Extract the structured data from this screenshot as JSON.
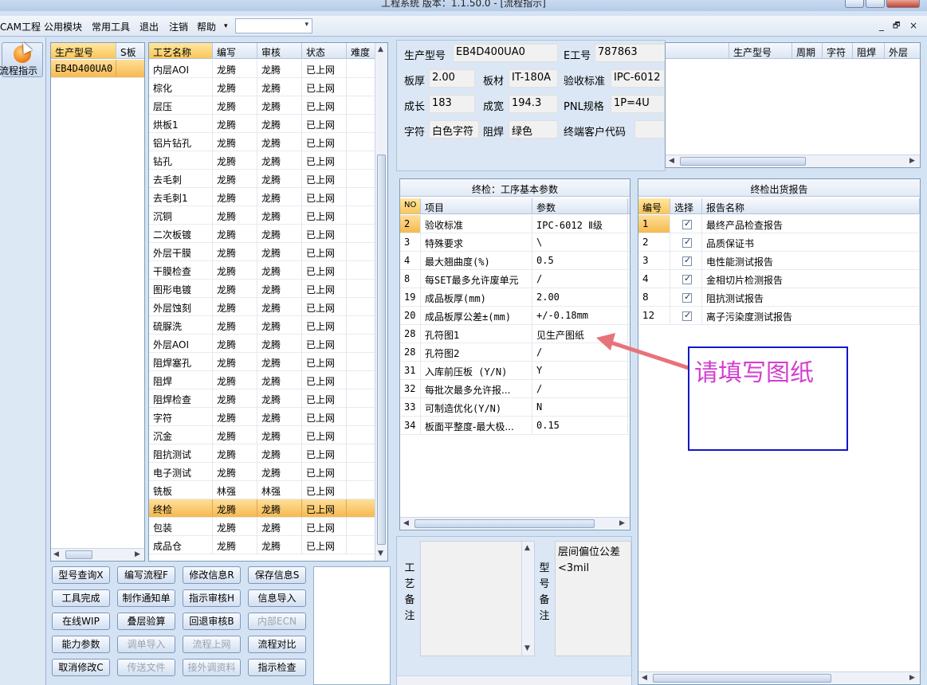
{
  "window": {
    "title": "工程系统   版本：1.1.50.0 - [流程指示]"
  },
  "menu": {
    "items": [
      "CAM工程",
      "公用模块",
      "常用工具",
      "退出",
      "注销",
      "帮助"
    ],
    "dropdown_arrow": "▾",
    "combo_value": ""
  },
  "mdi_controls": [
    "_",
    "🗗",
    "×"
  ],
  "nav": {
    "flow_button_label": "流程指示"
  },
  "product_list": {
    "headers": [
      "生产型号",
      "S板"
    ],
    "rows": [
      [
        "EB4D400UA0",
        ""
      ]
    ]
  },
  "process_table": {
    "headers": [
      "工艺名称",
      "编写",
      "审核",
      "状态",
      "难度"
    ],
    "rows": [
      [
        "内层AOI",
        "龙腾",
        "龙腾",
        "已上网",
        ""
      ],
      [
        "棕化",
        "龙腾",
        "龙腾",
        "已上网",
        ""
      ],
      [
        "层压",
        "龙腾",
        "龙腾",
        "已上网",
        ""
      ],
      [
        "烘板1",
        "龙腾",
        "龙腾",
        "已上网",
        ""
      ],
      [
        "铝片钻孔",
        "龙腾",
        "龙腾",
        "已上网",
        ""
      ],
      [
        "钻孔",
        "龙腾",
        "龙腾",
        "已上网",
        ""
      ],
      [
        "去毛刺",
        "龙腾",
        "龙腾",
        "已上网",
        ""
      ],
      [
        "去毛刺1",
        "龙腾",
        "龙腾",
        "已上网",
        ""
      ],
      [
        "沉铜",
        "龙腾",
        "龙腾",
        "已上网",
        ""
      ],
      [
        "二次板镀",
        "龙腾",
        "龙腾",
        "已上网",
        ""
      ],
      [
        "外层干膜",
        "龙腾",
        "龙腾",
        "已上网",
        ""
      ],
      [
        "干膜检查",
        "龙腾",
        "龙腾",
        "已上网",
        ""
      ],
      [
        "图形电镀",
        "龙腾",
        "龙腾",
        "已上网",
        ""
      ],
      [
        "外层蚀刻",
        "龙腾",
        "龙腾",
        "已上网",
        ""
      ],
      [
        "硫脲洗",
        "龙腾",
        "龙腾",
        "已上网",
        ""
      ],
      [
        "外层AOI",
        "龙腾",
        "龙腾",
        "已上网",
        ""
      ],
      [
        "阻焊塞孔",
        "龙腾",
        "龙腾",
        "已上网",
        ""
      ],
      [
        "阻焊",
        "龙腾",
        "龙腾",
        "已上网",
        ""
      ],
      [
        "阻焊检查",
        "龙腾",
        "龙腾",
        "已上网",
        ""
      ],
      [
        "字符",
        "龙腾",
        "龙腾",
        "已上网",
        ""
      ],
      [
        "沉金",
        "龙腾",
        "龙腾",
        "已上网",
        ""
      ],
      [
        "阻抗测试",
        "龙腾",
        "龙腾",
        "已上网",
        ""
      ],
      [
        "电子测试",
        "龙腾",
        "龙腾",
        "已上网",
        ""
      ],
      [
        "铣板",
        "林强",
        "林强",
        "已上网",
        ""
      ],
      [
        "终检",
        "龙腾",
        "龙腾",
        "已上网",
        ""
      ],
      [
        "包装",
        "龙腾",
        "龙腾",
        "已上网",
        ""
      ],
      [
        "成品仓",
        "龙腾",
        "龙腾",
        "已上网",
        ""
      ]
    ],
    "selected_row": "终检"
  },
  "buttons": [
    [
      "型号查询X",
      "编写流程F",
      "修改信息R",
      "保存信息S"
    ],
    [
      "工具完成",
      "制作通知单",
      "指示审核H",
      "信息导入"
    ],
    [
      "在线WIP",
      "叠层验算",
      "回退审核B",
      "内部ECN"
    ],
    [
      "能力参数",
      "调单导入",
      "流程上网",
      "流程对比"
    ],
    [
      "取消修改C",
      "传送文件",
      "接外调资料",
      "指示检查"
    ]
  ],
  "info": {
    "model_label": "生产型号",
    "model_value": "EB4D400UA0",
    "ework_label": "E工号",
    "ework_value": "787863",
    "thickness_label": "板厚",
    "thickness_value": "2.00",
    "material_label": "板材",
    "material_value": "IT-180A",
    "standard_label": "验收标准",
    "standard_value": "IPC-6012",
    "length_label": "成长",
    "length_value": "183",
    "width_label": "成宽",
    "width_value": "194.3",
    "pnl_label": "PNL规格",
    "pnl_value": "1P=4U",
    "char_label": "字符",
    "char_value": "白色字符",
    "mask_label": "阻焊",
    "mask_value": "绿色",
    "customer_label": "终端客户代码",
    "customer_value": ""
  },
  "mini_table": {
    "headers": [
      "",
      "生产型号",
      "周期",
      "字符",
      "阻焊",
      "外层"
    ]
  },
  "params": {
    "title": "终检：工序基本参数",
    "headers": [
      "NO",
      "项目",
      "参数"
    ],
    "rows": [
      [
        "2",
        "验收标准",
        "IPC-6012 Ⅱ级"
      ],
      [
        "3",
        "特殊要求",
        "\\"
      ],
      [
        "4",
        "最大翘曲度(%)",
        "0.5"
      ],
      [
        "8",
        "每SET最多允许废单元",
        "/"
      ],
      [
        "19",
        "成品板厚(mm)",
        "2.00"
      ],
      [
        "20",
        "成品板厚公差±(mm)",
        "+/-0.18mm"
      ],
      [
        "28",
        "孔符图1",
        "见生产图纸"
      ],
      [
        "28",
        "孔符图2",
        "/"
      ],
      [
        "31",
        "入库前压板 (Y/N)",
        "Y"
      ],
      [
        "32",
        "每批次最多允许报...",
        "/"
      ],
      [
        "33",
        "可制造优化(Y/N)",
        "N"
      ],
      [
        "34",
        "板面平整度-最大极...",
        "0.15"
      ]
    ]
  },
  "reports": {
    "title": "终检出货报告",
    "headers": [
      "编号",
      "选择",
      "报告名称"
    ],
    "rows": [
      [
        "1",
        "最终产品检查报告"
      ],
      [
        "2",
        "品质保证书"
      ],
      [
        "3",
        "电性能测试报告"
      ],
      [
        "4",
        "金相切片检测报告"
      ],
      [
        "8",
        "阻抗测试报告"
      ],
      [
        "12",
        "离子污染度测试报告"
      ]
    ]
  },
  "remarks": {
    "process_label": [
      "工",
      "艺",
      "备",
      "注"
    ],
    "model_label": [
      "型",
      "号",
      "备",
      "注"
    ],
    "model_text": "层间偏位公差<3mil"
  },
  "annotation": {
    "text": "请填写图纸",
    "color": "#d33fd0",
    "arrow_color": "#e8727a"
  }
}
